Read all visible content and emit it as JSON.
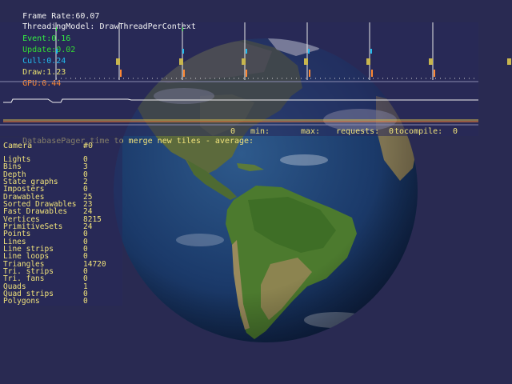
{
  "frame_rate": {
    "label": "Frame Rate:",
    "value": "60.07"
  },
  "threading_model": {
    "label": "ThreadingModel:",
    "value": "DrawThreadPerContext"
  },
  "timing": {
    "event": {
      "label": "Event:",
      "value": "0.16",
      "color": "#33ee44"
    },
    "update": {
      "label": "Update:",
      "value": "0.02",
      "color": "#33dd33"
    },
    "cull": {
      "label": "Cull:",
      "value": "0.24",
      "color": "#22bbee"
    },
    "draw": {
      "label": "Draw:",
      "value": "1.23",
      "color": "#e8e070"
    },
    "gpu": {
      "label": "GPU:",
      "value": "0.44",
      "color": "#ff8833"
    }
  },
  "database_pager": {
    "label": "DatabasePager time to merge new tiles - average:",
    "average": "0",
    "min_label": "min:",
    "max_label": "max:",
    "requests_label": "requests:",
    "requests": "0",
    "tocompile_label": "tocompile:",
    "tocompile": "0"
  },
  "camera": {
    "label": "Camera",
    "value": "#0"
  },
  "stats": [
    {
      "label": "Lights",
      "value": "0"
    },
    {
      "label": "Bins",
      "value": "3"
    },
    {
      "label": "Depth",
      "value": "0"
    },
    {
      "label": "State graphs",
      "value": "2"
    },
    {
      "label": "Imposters",
      "value": "0"
    },
    {
      "label": "Drawables",
      "value": "25"
    },
    {
      "label": "Sorted Drawables",
      "value": "23"
    },
    {
      "label": "Fast Drawables",
      "value": "24"
    },
    {
      "label": "Vertices",
      "value": "8215"
    },
    {
      "label": "PrimitiveSets",
      "value": "24"
    },
    {
      "label": "Points",
      "value": "0"
    },
    {
      "label": "Lines",
      "value": "0"
    },
    {
      "label": "Line strips",
      "value": "0"
    },
    {
      "label": "Line loops",
      "value": "0"
    },
    {
      "label": "Triangles",
      "value": "14720"
    },
    {
      "label": "Tri. strips",
      "value": "0"
    },
    {
      "label": "Tri. fans",
      "value": "0"
    },
    {
      "label": "Quads",
      "value": "1"
    },
    {
      "label": "Quad strips",
      "value": "0"
    },
    {
      "label": "Polygons",
      "value": "0"
    }
  ]
}
